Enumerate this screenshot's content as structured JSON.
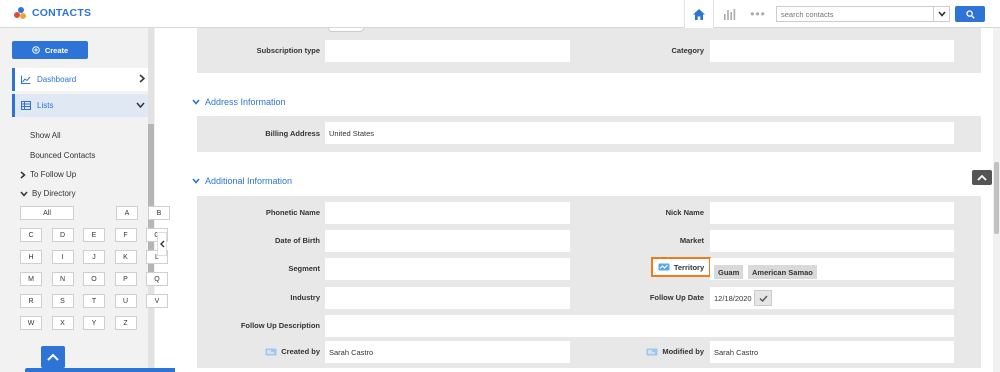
{
  "app": {
    "title": "CONTACTS",
    "brand_colors": {
      "accent": "#2d74d6",
      "highlight": "#f07a1d"
    }
  },
  "header": {
    "search_placeholder": "search contacts"
  },
  "sidebar": {
    "create_label": "Create",
    "dashboard_label": "Dashboard",
    "lists_label": "Lists",
    "show_all": "Show All",
    "bounced_contacts": "Bounced Contacts",
    "to_follow_up": "To Follow Up",
    "by_directory": "By Directory",
    "alpha_all": "All",
    "alpha_first_row": [
      "A",
      "B"
    ],
    "alpha_rest": [
      "C",
      "D",
      "E",
      "F",
      "G",
      "H",
      "I",
      "J",
      "K",
      "L",
      "M",
      "N",
      "O",
      "P",
      "Q",
      "R",
      "S",
      "T",
      "U",
      "V",
      "W",
      "X",
      "Y",
      "Z"
    ]
  },
  "subscription": {
    "subscription_type_label": "Subscription type",
    "subscription_type_value": "",
    "category_label": "Category",
    "category_value": ""
  },
  "address": {
    "section_title": "Address Information",
    "billing_label": "Billing Address",
    "billing_value": "United States"
  },
  "additional": {
    "section_title": "Additional Information",
    "phonetic_label": "Phonetic Name",
    "phonetic_value": "",
    "nick_label": "Nick Name",
    "nick_value": "",
    "dob_label": "Date of Birth",
    "dob_value": "",
    "market_label": "Market",
    "market_value": "",
    "segment_label": "Segment",
    "segment_value": "",
    "territory_label": "Territory",
    "territory_tags": [
      "Guam",
      "American Samao"
    ],
    "industry_label": "Industry",
    "industry_value": "",
    "follow_up_date_label": "Follow Up Date",
    "follow_up_date_value": "12/18/2020",
    "follow_up_desc_label": "Follow Up Description",
    "follow_up_desc_value": "",
    "created_by_label": "Created by",
    "created_by_value": "Sarah Castro",
    "modified_by_label": "Modified by",
    "modified_by_value": "Sarah Castro"
  }
}
